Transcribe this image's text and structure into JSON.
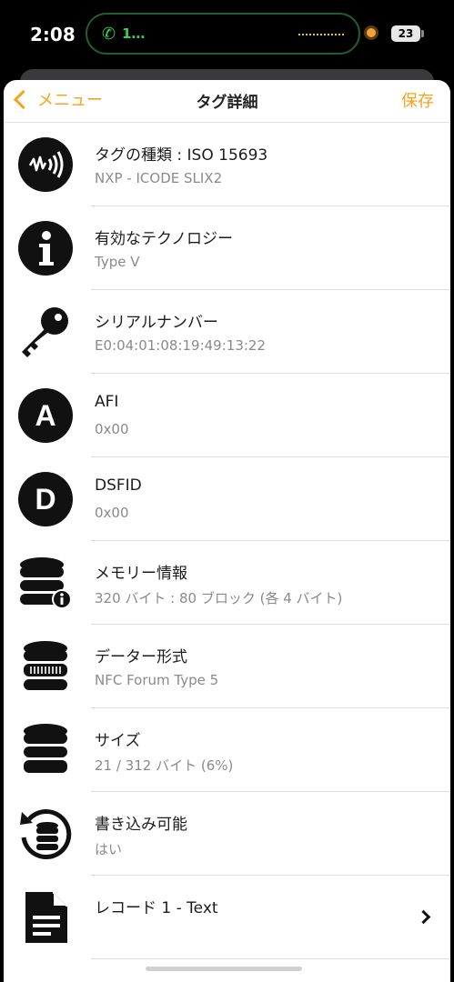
{
  "status_bar": {
    "time": "2:08",
    "call_label": "1…",
    "battery": "23"
  },
  "nav": {
    "back_label": "メニュー",
    "title": "タグ詳細",
    "save_label": "保存"
  },
  "rows": [
    {
      "title": "タグの種類 : ISO 15693",
      "subtitle": "NXP - ICODE SLIX2",
      "icon": "nfc-signal-icon"
    },
    {
      "title": "有効なテクノロジー",
      "subtitle": "Type V",
      "icon": "info-icon"
    },
    {
      "title": "シリアルナンバー",
      "subtitle": "E0:04:01:08:19:49:13:22",
      "icon": "key-icon"
    },
    {
      "title": "AFI",
      "subtitle": "0x00",
      "icon": "letter-a-icon",
      "icon_letter": "A"
    },
    {
      "title": "DSFID",
      "subtitle": "0x00",
      "icon": "letter-d-icon",
      "icon_letter": "D"
    },
    {
      "title": "メモリー情報",
      "subtitle": "320 バイト : 80 ブロック (各 4 バイト)",
      "icon": "database-info-icon"
    },
    {
      "title": "データー形式",
      "subtitle": "NFC Forum Type 5",
      "icon": "database-format-icon"
    },
    {
      "title": "サイズ",
      "subtitle": "21 / 312 バイト (6%)",
      "icon": "database-icon"
    },
    {
      "title": "書き込み可能",
      "subtitle": "はい",
      "icon": "database-rewrite-icon"
    },
    {
      "title": "レコード 1 - Text",
      "subtitle": "",
      "icon": "document-icon"
    }
  ],
  "colors": {
    "accent": "#f4a320",
    "call_green": "#36d05a"
  }
}
